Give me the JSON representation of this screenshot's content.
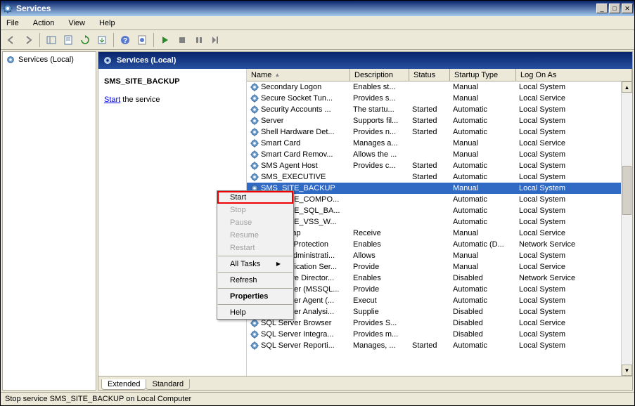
{
  "window": {
    "title": "Services"
  },
  "menu": {
    "file": "File",
    "action": "Action",
    "view": "View",
    "help": "Help"
  },
  "tree": {
    "root": "Services (Local)"
  },
  "pane": {
    "title": "Services (Local)"
  },
  "detail": {
    "name": "SMS_SITE_BACKUP",
    "action_link": "Start",
    "action_suffix": " the service"
  },
  "columns": {
    "name": "Name",
    "description": "Description",
    "status": "Status",
    "startup": "Startup Type",
    "logon": "Log On As"
  },
  "services": [
    {
      "name": "Secondary Logon",
      "desc": "Enables st...",
      "status": "",
      "startup": "Manual",
      "logon": "Local System"
    },
    {
      "name": "Secure Socket Tun...",
      "desc": "Provides s...",
      "status": "",
      "startup": "Manual",
      "logon": "Local Service"
    },
    {
      "name": "Security Accounts ...",
      "desc": "The startu...",
      "status": "Started",
      "startup": "Automatic",
      "logon": "Local System"
    },
    {
      "name": "Server",
      "desc": "Supports fil...",
      "status": "Started",
      "startup": "Automatic",
      "logon": "Local System"
    },
    {
      "name": "Shell Hardware Det...",
      "desc": "Provides n...",
      "status": "Started",
      "startup": "Automatic",
      "logon": "Local System"
    },
    {
      "name": "Smart Card",
      "desc": "Manages a...",
      "status": "",
      "startup": "Manual",
      "logon": "Local Service"
    },
    {
      "name": "Smart Card Remov...",
      "desc": "Allows the ...",
      "status": "",
      "startup": "Manual",
      "logon": "Local System"
    },
    {
      "name": "SMS Agent Host",
      "desc": "Provides c...",
      "status": "Started",
      "startup": "Automatic",
      "logon": "Local System"
    },
    {
      "name": "SMS_EXECUTIVE",
      "desc": "",
      "status": "Started",
      "startup": "Automatic",
      "logon": "Local System"
    },
    {
      "name": "SMS_SITE_BACKUP",
      "desc": "",
      "status": "",
      "startup": "Manual",
      "logon": "Local System",
      "selected": true
    },
    {
      "name": "SMS_SITE_COMPO...",
      "desc": "",
      "status": "",
      "startup": "Automatic",
      "logon": "Local System"
    },
    {
      "name": "SMS_SITE_SQL_BA...",
      "desc": "",
      "status": "",
      "startup": "Automatic",
      "logon": "Local System"
    },
    {
      "name": "SMS_SITE_VSS_W...",
      "desc": "",
      "status": "",
      "startup": "Automatic",
      "logon": "Local System"
    },
    {
      "name": "SNMP Trap",
      "desc": "Receive",
      "status": "",
      "startup": "Manual",
      "logon": "Local Service"
    },
    {
      "name": "Software Protection",
      "desc": "Enables",
      "status": "",
      "startup": "Automatic (D...",
      "logon": "Network Service"
    },
    {
      "name": "Special Administrati...",
      "desc": "Allows",
      "status": "",
      "startup": "Manual",
      "logon": "Local System"
    },
    {
      "name": "SPP Notification Ser...",
      "desc": "Provide",
      "status": "",
      "startup": "Manual",
      "logon": "Local Service"
    },
    {
      "name": "SQL Active Director...",
      "desc": "Enables",
      "status": "",
      "startup": "Disabled",
      "logon": "Network Service"
    },
    {
      "name": "SQL Server (MSSQL...",
      "desc": "Provide",
      "status": "",
      "startup": "Automatic",
      "logon": "Local System"
    },
    {
      "name": "SQL Server Agent (...",
      "desc": "Execut",
      "status": "",
      "startup": "Automatic",
      "logon": "Local System"
    },
    {
      "name": "SQL Server Analysi...",
      "desc": "Supplie",
      "status": "",
      "startup": "Disabled",
      "logon": "Local System"
    },
    {
      "name": "SQL Server Browser",
      "desc": "Provides S...",
      "status": "",
      "startup": "Disabled",
      "logon": "Local Service"
    },
    {
      "name": "SQL Server Integra...",
      "desc": "Provides m...",
      "status": "",
      "startup": "Disabled",
      "logon": "Local System"
    },
    {
      "name": "SQL Server Reporti...",
      "desc": "Manages, ...",
      "status": "Started",
      "startup": "Automatic",
      "logon": "Local System"
    }
  ],
  "context_menu": {
    "start": "Start",
    "stop": "Stop",
    "pause": "Pause",
    "resume": "Resume",
    "restart": "Restart",
    "all_tasks": "All Tasks",
    "refresh": "Refresh",
    "properties": "Properties",
    "help": "Help"
  },
  "tabs": {
    "extended": "Extended",
    "standard": "Standard"
  },
  "statusbar": "Stop service SMS_SITE_BACKUP on Local Computer"
}
